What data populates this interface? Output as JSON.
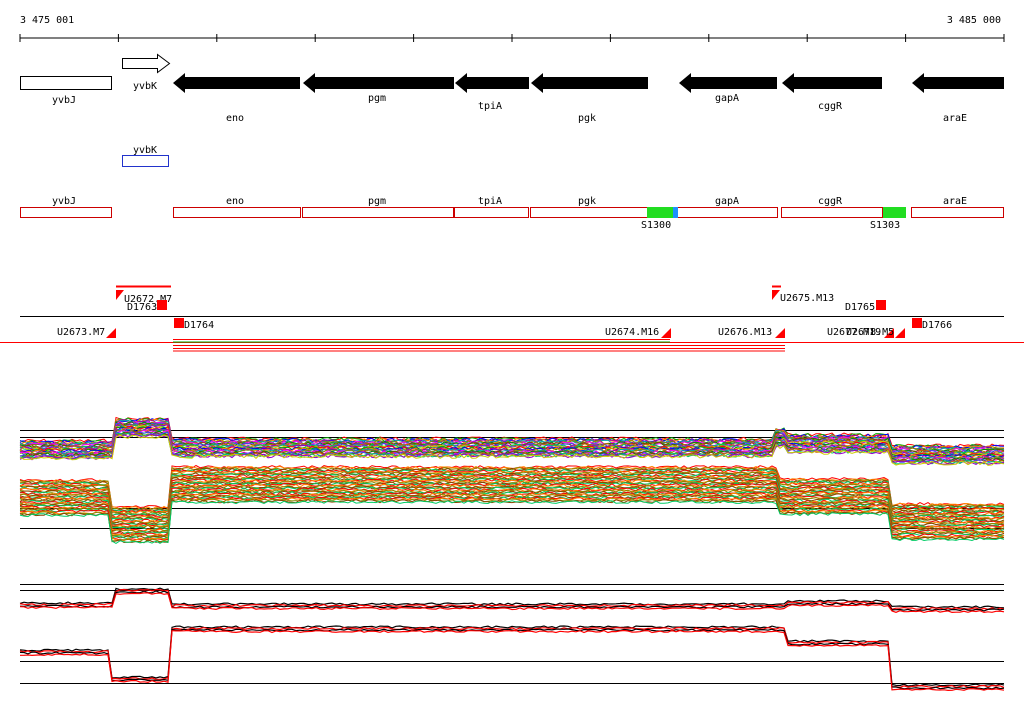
{
  "ruler": {
    "start_label": "3 475 001",
    "end_label": "3 485 000"
  },
  "genes_track": [
    {
      "name": "yvbJ",
      "strand": "+",
      "style": "outline"
    },
    {
      "name": "yvbK",
      "strand": "+",
      "style": "outline"
    },
    {
      "name": "eno",
      "strand": "-",
      "style": "filled"
    },
    {
      "name": "pgm",
      "strand": "-",
      "style": "filled"
    },
    {
      "name": "tpiA",
      "strand": "-",
      "style": "filled"
    },
    {
      "name": "pgk",
      "strand": "-",
      "style": "filled"
    },
    {
      "name": "gapA",
      "strand": "-",
      "style": "filled"
    },
    {
      "name": "cggR",
      "strand": "-",
      "style": "filled"
    },
    {
      "name": "araE",
      "strand": "-",
      "style": "filled"
    }
  ],
  "blue_feature": {
    "name": "yvbK",
    "color": "#2233cc"
  },
  "annotation_track": {
    "boxes": [
      "yvbJ",
      "eno",
      "pgm",
      "tpiA",
      "pgk",
      "gapA",
      "cggR",
      "araE"
    ],
    "sites": [
      "S1300",
      "S1303"
    ],
    "box_color": "#cc0000",
    "site_color": "#22dd22",
    "site_accent": "#1e90ff"
  },
  "transcripts": {
    "labels": [
      "U2673.M7",
      "U2672.M7",
      "D1763",
      "D1764",
      "U2674.M16",
      "U2676.M13",
      "U2675.M13",
      "D1765",
      "U2677.M19",
      "U2678.M5",
      "D1766"
    ],
    "color": "#ff0000"
  },
  "colors": {
    "gene_fill": "#000000",
    "profile_palette": [
      "#ff0000",
      "#00aa00",
      "#0000ff",
      "#ff8800",
      "#aa00aa",
      "#00aaaa",
      "#888800",
      "#ff00ff",
      "#008800",
      "#884400",
      "#4444ff",
      "#cc6600",
      "#00cc66",
      "#9900cc",
      "#cccc00"
    ],
    "summary_black": "#000000",
    "summary_red": "#ff0000"
  }
}
